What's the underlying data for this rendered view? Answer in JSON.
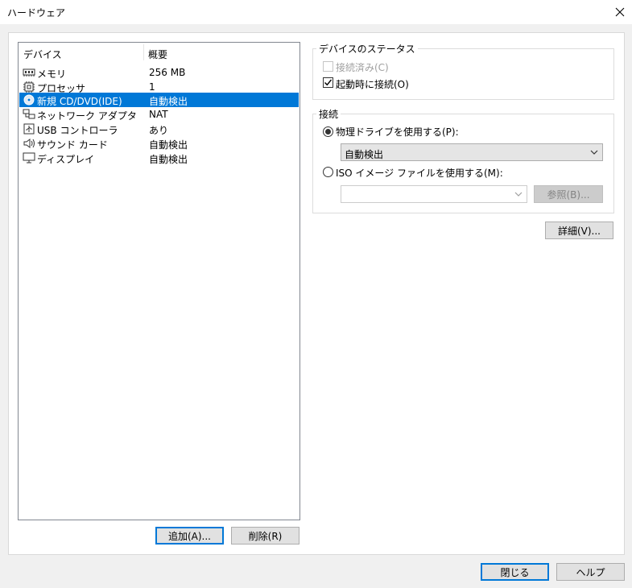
{
  "window": {
    "title": "ハードウェア"
  },
  "device_list": {
    "columns": [
      "デバイス",
      "概要"
    ],
    "rows": [
      {
        "icon": "memory-icon",
        "name": "メモリ",
        "summary": "256 MB",
        "selected": false
      },
      {
        "icon": "processor-icon",
        "name": "プロセッサ",
        "summary": "1",
        "selected": false
      },
      {
        "icon": "cd-dvd-icon",
        "name": "新規 CD/DVD(IDE)",
        "summary": "自動検出",
        "selected": true
      },
      {
        "icon": "network-adapter-icon",
        "name": "ネットワーク アダプタ",
        "summary": "NAT",
        "selected": false
      },
      {
        "icon": "usb-controller-icon",
        "name": "USB コントローラ",
        "summary": "あり",
        "selected": false
      },
      {
        "icon": "sound-card-icon",
        "name": "サウンド カード",
        "summary": "自動検出",
        "selected": false
      },
      {
        "icon": "display-icon",
        "name": "ディスプレイ",
        "summary": "自動検出",
        "selected": false
      }
    ]
  },
  "list_buttons": {
    "add": "追加(A)...",
    "remove": "削除(R)"
  },
  "device_status": {
    "title": "デバイスのステータス",
    "connected_label": "接続済み(C)",
    "connected_checked": false,
    "connect_at_power_on_label": "起動時に接続(O)",
    "connect_at_power_on_checked": true
  },
  "connection": {
    "title": "接続",
    "physical_drive_label": "物理ドライブを使用する(P):",
    "physical_drive_value": "自動検出",
    "iso_label": "ISO イメージ ファイルを使用する(M):",
    "iso_value": "",
    "browse_label": "参照(B)...",
    "selected": "physical"
  },
  "advanced_button": "詳細(V)...",
  "footer": {
    "close": "閉じる",
    "help": "ヘルプ"
  },
  "colors": {
    "selection": "#0078d7",
    "border": "#adadad",
    "background": "#f0f0f0"
  }
}
